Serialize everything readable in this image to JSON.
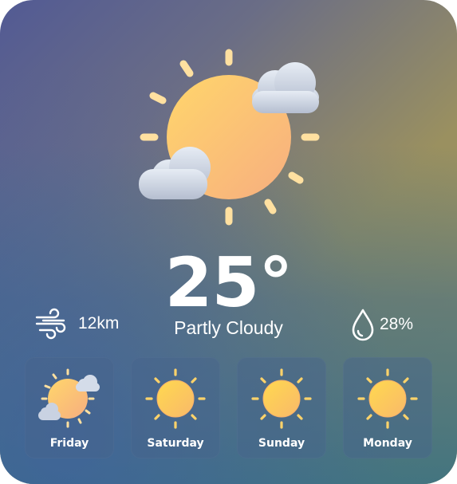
{
  "current": {
    "temperature": "25°",
    "condition": "Partly Cloudy",
    "icon": "sun-with-clouds-icon"
  },
  "stats": {
    "wind": {
      "icon": "wind-icon",
      "value": "12km"
    },
    "humidity": {
      "icon": "raindrop-icon",
      "value": "28%"
    }
  },
  "forecast": [
    {
      "day": "Friday",
      "icon": "sun-with-clouds-icon"
    },
    {
      "day": "Saturday",
      "icon": "sun-icon"
    },
    {
      "day": "Sunday",
      "icon": "sun-icon"
    },
    {
      "day": "Monday",
      "icon": "sun-icon"
    }
  ],
  "colors": {
    "sun_light": "#ffd56b",
    "sun_dark": "#f7b27a",
    "cloud": "#d4dce9",
    "text": "#ffffff"
  }
}
